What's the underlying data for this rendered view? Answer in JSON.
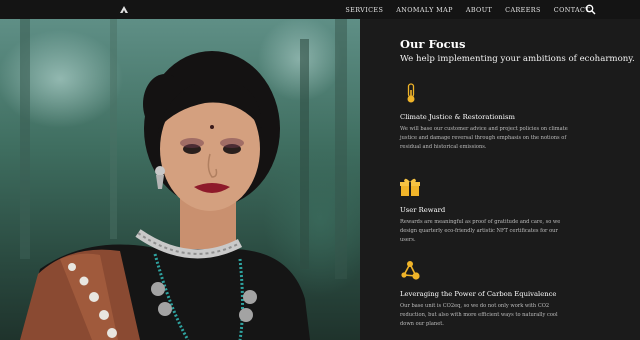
{
  "nav": {
    "items": [
      "SERVICES",
      "ANOMALY MAP",
      "ABOUT",
      "CAREERS",
      "CONTACT"
    ]
  },
  "focus": {
    "title": "Our Focus",
    "subtitle": "We help implementing your ambitions of ecoharmony."
  },
  "features": [
    {
      "icon": "thermometer-icon",
      "title": "Climate Justice & Restorationism",
      "text": "We will base our customer advice and project policies on climate justice and damage reversal through emphasis on the notions of residual and historical emissions."
    },
    {
      "icon": "gift-icon",
      "title": "User Reward",
      "text": "Rewards are meaningful as proof of gratitude and care, so we design quarterly eco-friendly artistic NFT certificates for our users."
    },
    {
      "icon": "network-icon",
      "title": "Leveraging the Power of Carbon Equivalence",
      "text": "Our base unit is CO2eq, so we do not only work with CO2 reduction, but also with more efficient ways to naturally cool down our planet."
    }
  ],
  "colors": {
    "accent": "#f0b429",
    "background": "#1b1b1b",
    "topbar": "#141414"
  }
}
